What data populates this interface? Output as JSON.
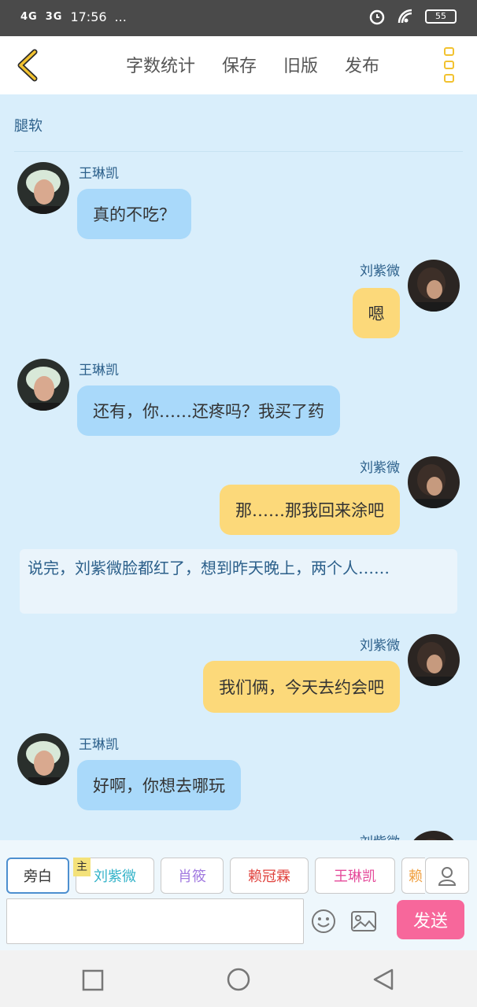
{
  "status": {
    "net1": "4G",
    "net2": "3G",
    "time": "17:56",
    "more": "...",
    "battery": "55"
  },
  "toolbar": {
    "word_count": "字数统计",
    "save": "保存",
    "old_version": "旧版",
    "publish": "发布"
  },
  "story": {
    "title": "腿软"
  },
  "messages": [
    {
      "sender": "王琳凯",
      "text": "真的不吃？",
      "side": "left"
    },
    {
      "sender": "刘紫微",
      "text": "嗯",
      "side": "right"
    },
    {
      "sender": "王琳凯",
      "text": "还有，你……还疼吗？我买了药",
      "side": "left"
    },
    {
      "sender": "刘紫微",
      "text": "那……那我回来涂吧",
      "side": "right"
    },
    {
      "narration": "说完，刘紫微脸都红了，想到昨天晚上，两个人……"
    },
    {
      "sender": "刘紫微",
      "text": "我们俩，今天去约会吧",
      "side": "right"
    },
    {
      "sender": "王琳凯",
      "text": "好啊，你想去哪玩",
      "side": "left"
    },
    {
      "sender": "刘紫微",
      "text": "",
      "side": "right"
    }
  ],
  "characters": {
    "selected": "旁白",
    "main_tag": "主",
    "list": [
      {
        "name": "旁白",
        "color": "#333333"
      },
      {
        "name": "刘紫微",
        "color": "#35b3c9"
      },
      {
        "name": "肖筱",
        "color": "#a27be0"
      },
      {
        "name": "赖冠霖",
        "color": "#e0423d"
      },
      {
        "name": "王琳凯",
        "color": "#e54a9a"
      },
      {
        "name": "赖",
        "color": "#f0a040"
      }
    ]
  },
  "composer": {
    "placeholder": "",
    "send": "发送"
  },
  "colors": {
    "left_bubble": "#a9d9fa",
    "right_bubble": "#fcd97a",
    "send_button": "#f7679b",
    "accent": "#f2c230"
  }
}
